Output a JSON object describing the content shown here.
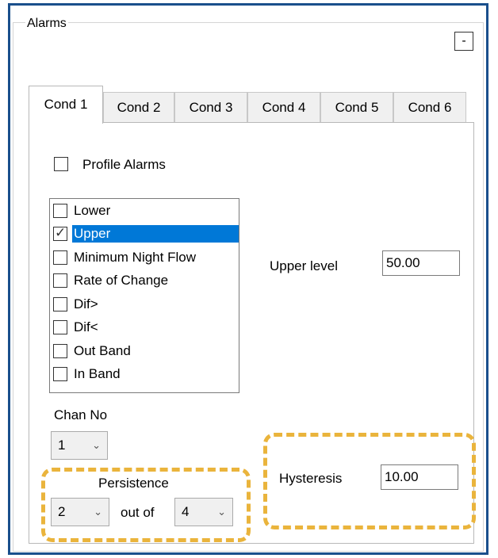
{
  "group": {
    "title": "Alarms",
    "collapse_label": "-"
  },
  "tabs": [
    {
      "label": "Cond 1",
      "active": true
    },
    {
      "label": "Cond 2",
      "active": false
    },
    {
      "label": "Cond 3",
      "active": false
    },
    {
      "label": "Cond 4",
      "active": false
    },
    {
      "label": "Cond 5",
      "active": false
    },
    {
      "label": "Cond 6",
      "active": false
    }
  ],
  "profile_alarms": {
    "label": "Profile Alarms",
    "checked": false
  },
  "alarm_types": [
    {
      "label": "Lower",
      "checked": false,
      "selected": false
    },
    {
      "label": "Upper",
      "checked": true,
      "selected": true
    },
    {
      "label": "Minimum Night Flow",
      "checked": false,
      "selected": false
    },
    {
      "label": "Rate of Change",
      "checked": false,
      "selected": false
    },
    {
      "label": "Dif>",
      "checked": false,
      "selected": false
    },
    {
      "label": "Dif<",
      "checked": false,
      "selected": false
    },
    {
      "label": "Out Band",
      "checked": false,
      "selected": false
    },
    {
      "label": "In Band",
      "checked": false,
      "selected": false
    }
  ],
  "upper_level": {
    "label": "Upper level",
    "value": "50.00"
  },
  "chan_no": {
    "label": "Chan No",
    "value": "1"
  },
  "persistence": {
    "label": "Persistence",
    "count": "2",
    "out_of_label": "out of",
    "window": "4"
  },
  "hysteresis": {
    "label": "Hysteresis",
    "value": "10.00"
  },
  "colors": {
    "frame": "#1a4f8c",
    "selection": "#0078d7",
    "highlight": "#eab43c"
  },
  "icons": {
    "dropdown": "chevron-down-icon",
    "check": "checkmark-icon"
  }
}
